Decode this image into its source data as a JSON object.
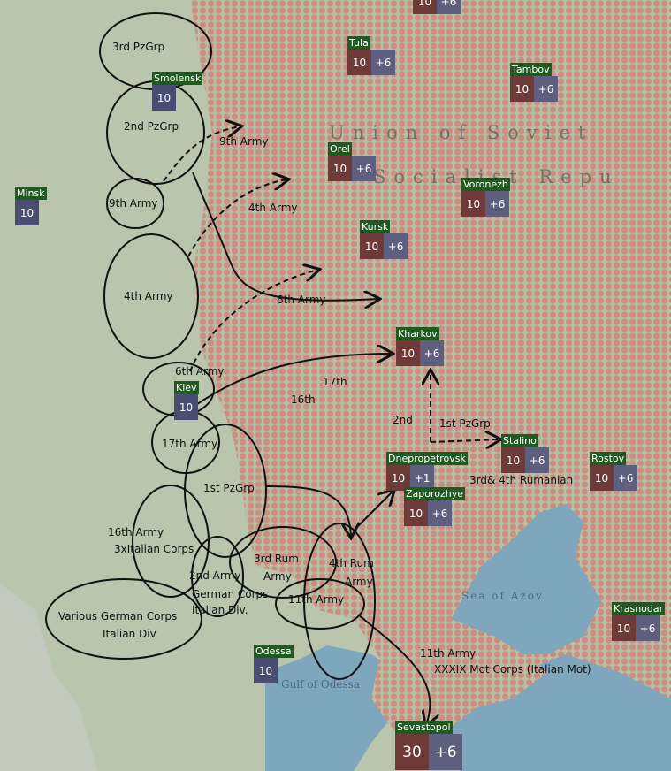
{
  "colors": {
    "land": "#b9c5ad",
    "soviet": "#c7a597",
    "hex": "#c98f82",
    "sea": "#7ea6bd",
    "city_label": "#1f5a1f",
    "city_red": "#6e3a38",
    "city_blue": "#5e5e7e"
  },
  "cities": [
    {
      "name": "",
      "v1": "10",
      "v2": "+6"
    },
    {
      "name": "Tula",
      "v1": "10",
      "v2": "+6"
    },
    {
      "name": "Tambov",
      "v1": "10",
      "v2": "+6"
    },
    {
      "name": "Smolensk",
      "v1": "10"
    },
    {
      "name": "Orel",
      "v1": "10",
      "v2": "+6"
    },
    {
      "name": "Voronezh",
      "v1": "10",
      "v2": "+6"
    },
    {
      "name": "Minsk",
      "v1": "10"
    },
    {
      "name": "Kursk",
      "v1": "10",
      "v2": "+6"
    },
    {
      "name": "Kharkov",
      "v1": "10",
      "v2": "+6"
    },
    {
      "name": "Kiev",
      "v1": "10"
    },
    {
      "name": "Dnepropetrovsk",
      "v1": "10",
      "v2": "+1"
    },
    {
      "name": "Stalino",
      "v1": "10",
      "v2": "+6"
    },
    {
      "name": "Rostov",
      "v1": "10",
      "v2": "+6"
    },
    {
      "name": "Zaporozhye",
      "v1": "10",
      "v2": "+6"
    },
    {
      "name": "Krasnodar",
      "v1": "10",
      "v2": "+6"
    },
    {
      "name": "Odessa",
      "v1": "10"
    },
    {
      "name": "Sevastopol",
      "v1": "30",
      "v2": "+6"
    }
  ],
  "geo_labels": {
    "ussr1": "Union of Soviet",
    "ussr2": "Socialist Repu",
    "azov": "Sea of Azov",
    "odessa_gulf": "Gulf of Odessa"
  },
  "annotations": [
    "3rd PzGrp",
    "2nd PzGrp",
    "9th Army",
    "9th Army",
    "4th Army",
    "4th Army",
    "6th Army",
    "6th Army",
    "17th",
    "16th",
    "17th Army",
    "1st PzGrp",
    "2nd",
    "1st PzGrp",
    "3rd& 4th Rumanian",
    "16th Army",
    "3xItalian Corps",
    "2nd Army",
    "German Corps",
    "Italian Div.",
    "3rd Rum",
    "Army",
    "4th Rum",
    "Army",
    "11th Army",
    "Various German Corps",
    "Italian Div",
    "11th Army",
    "XXXIX Mot Corps (Italian Mot)"
  ]
}
